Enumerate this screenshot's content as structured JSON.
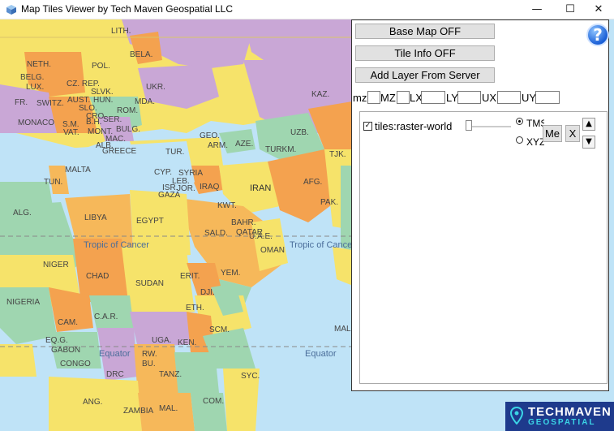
{
  "window": {
    "title": "Map Tiles Viewer by Tech Maven Geospatial LLC",
    "minimize": "—",
    "maximize": "☐",
    "close": "✕"
  },
  "panel": {
    "base_map_btn": "Base Map OFF",
    "tile_info_btn": "Tile Info OFF",
    "add_layer_btn": "Add Layer From Server",
    "help_label": "?",
    "bbox": {
      "mz": "mz",
      "MZ": "MZ",
      "LX": "LX",
      "LY": "LY",
      "UX": "UX",
      "UY": "UY"
    },
    "layer": {
      "checked": "✓",
      "name": "tiles:raster-world",
      "radio_tms": "TMS",
      "radio_xyz": "XYZ",
      "selected_radio": "TMS",
      "me_btn": "Me",
      "x_btn": "X",
      "up": "▲",
      "down": "▼"
    }
  },
  "logo": {
    "line1": "TECHMAVEN",
    "line2": "GEOSPATIAL"
  },
  "map_labels": {
    "lith": "LITH.",
    "bela": "BELA.",
    "neth": "NETH.",
    "pol": "POL.",
    "belg": "BELG.",
    "lux": "LUX.",
    "czrep": "CZ. REP.",
    "slvk": "SLVK.",
    "ukr": "UKR.",
    "fr": "FR.",
    "aust": "AUST.",
    "hun": "HUN.",
    "switz": "SWITZ.",
    "slo": "SLO.",
    "cro": "CRO.",
    "rom": "ROM.",
    "mda": "MDA.",
    "kaz": "KAZ.",
    "bh": "B.H.",
    "monaco": "MONACO",
    "sm": "S.M.",
    "ser": "SER.",
    "bulg": "BULG.",
    "vat": "VAT.",
    "mont": "MONT.",
    "mac": "MAC.",
    "alb": "ALB.",
    "greece": "GREECE",
    "geo": "GEO.",
    "arm": "ARM.",
    "aze": "AZE.",
    "uzb": "UZB.",
    "tur": "TUR.",
    "turkm": "TURKM.",
    "tjk": "TJK.",
    "malta": "MALTA",
    "tun": "TUN.",
    "cyp": "CYP.",
    "syria": "SYRIA",
    "leb": "LEB.",
    "iraq": "IRAQ",
    "iran": "IRAN",
    "afg": "AFG.",
    "isr": "ISR.",
    "jor": "JOR.",
    "gaza": "GAZA",
    "kwt": "KWT.",
    "bahr": "BAHR.",
    "qatar": "QATAR",
    "uae": "U.A.E.",
    "pak": "PAK.",
    "alg": "ALG.",
    "libya": "LIBYA",
    "egypt": "EGYPT",
    "sald": "SALD.",
    "oman": "OMAN",
    "tropic1": "Tropic of Cancer",
    "tropic2": "Tropic of Cancer",
    "niger": "NIGER",
    "chad": "CHAD",
    "sudan": "SUDAN",
    "erit": "ERIT.",
    "yem": "YEM.",
    "dji": "DJI.",
    "nigeria": "NIGERIA",
    "car": "C.A.R.",
    "eth": "ETH.",
    "scm": "SCM.",
    "cam": "CAM.",
    "eqg": "EQ.G.",
    "gabon": "GABON",
    "uga": "UGA.",
    "ken": "KEN.",
    "rw": "RW.",
    "bu": "BU.",
    "equator1": "Equator",
    "equator2": "Equator",
    "congo": "CONGO",
    "drc": "DRC",
    "tanz": "TANZ.",
    "syc": "SYC.",
    "mald": "MALD",
    "ang": "ANG.",
    "mal": "MAL.",
    "com": "COM.",
    "zambia": "ZAMBIA"
  }
}
